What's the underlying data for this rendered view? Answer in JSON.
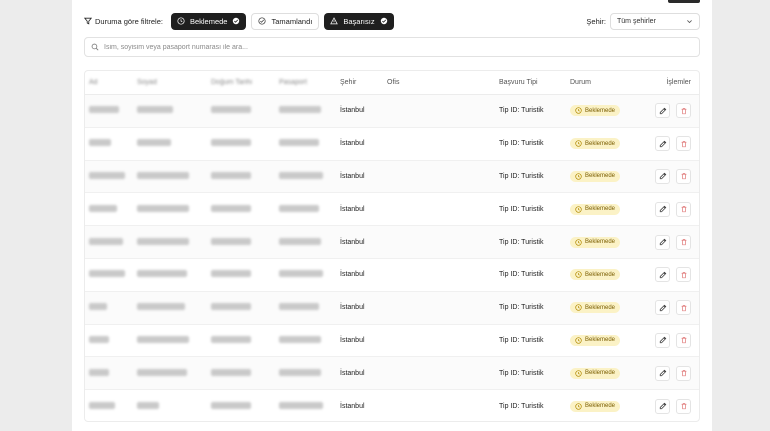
{
  "filters": {
    "label": "Duruma göre filtrele:",
    "chips": [
      {
        "label": "Beklemede",
        "active": true,
        "icon": "clock-icon"
      },
      {
        "label": "Tamamlandı",
        "active": false,
        "icon": "check-circle-icon"
      },
      {
        "label": "Başarısız",
        "active": true,
        "icon": "warning-icon"
      }
    ]
  },
  "city": {
    "label": "Şehir:",
    "selected": "Tüm şehirler"
  },
  "search": {
    "placeholder": "İsim, soyisim veya pasaport numarası ile ara..."
  },
  "table": {
    "headers": [
      "Ad",
      "Soyad",
      "Doğum Tarihi",
      "Pasaport",
      "Şehir",
      "Ofis",
      "Başvuru Tipi",
      "Durum",
      "İşlemler"
    ],
    "rows": [
      {
        "city": "İstanbul",
        "type": "Tip ID: Turistik",
        "status": "Beklemede"
      },
      {
        "city": "İstanbul",
        "type": "Tip ID: Turistik",
        "status": "Beklemede"
      },
      {
        "city": "İstanbul",
        "type": "Tip ID: Turistik",
        "status": "Beklemede"
      },
      {
        "city": "İstanbul",
        "type": "Tip ID: Turistik",
        "status": "Beklemede"
      },
      {
        "city": "İstanbul",
        "type": "Tip ID: Turistik",
        "status": "Beklemede"
      },
      {
        "city": "İstanbul",
        "type": "Tip ID: Turistik",
        "status": "Beklemede"
      },
      {
        "city": "İstanbul",
        "type": "Tip ID: Turistik",
        "status": "Beklemede"
      },
      {
        "city": "İstanbul",
        "type": "Tip ID: Turistik",
        "status": "Beklemede"
      },
      {
        "city": "İstanbul",
        "type": "Tip ID: Turistik",
        "status": "Beklemede"
      },
      {
        "city": "İstanbul",
        "type": "Tip ID: Turistik",
        "status": "Beklemede"
      }
    ]
  },
  "colors": {
    "accent": "#1f1f1f",
    "pending_bg": "#fbf2c6",
    "pending_text": "#7a5d00",
    "delete": "#e07a7a"
  }
}
